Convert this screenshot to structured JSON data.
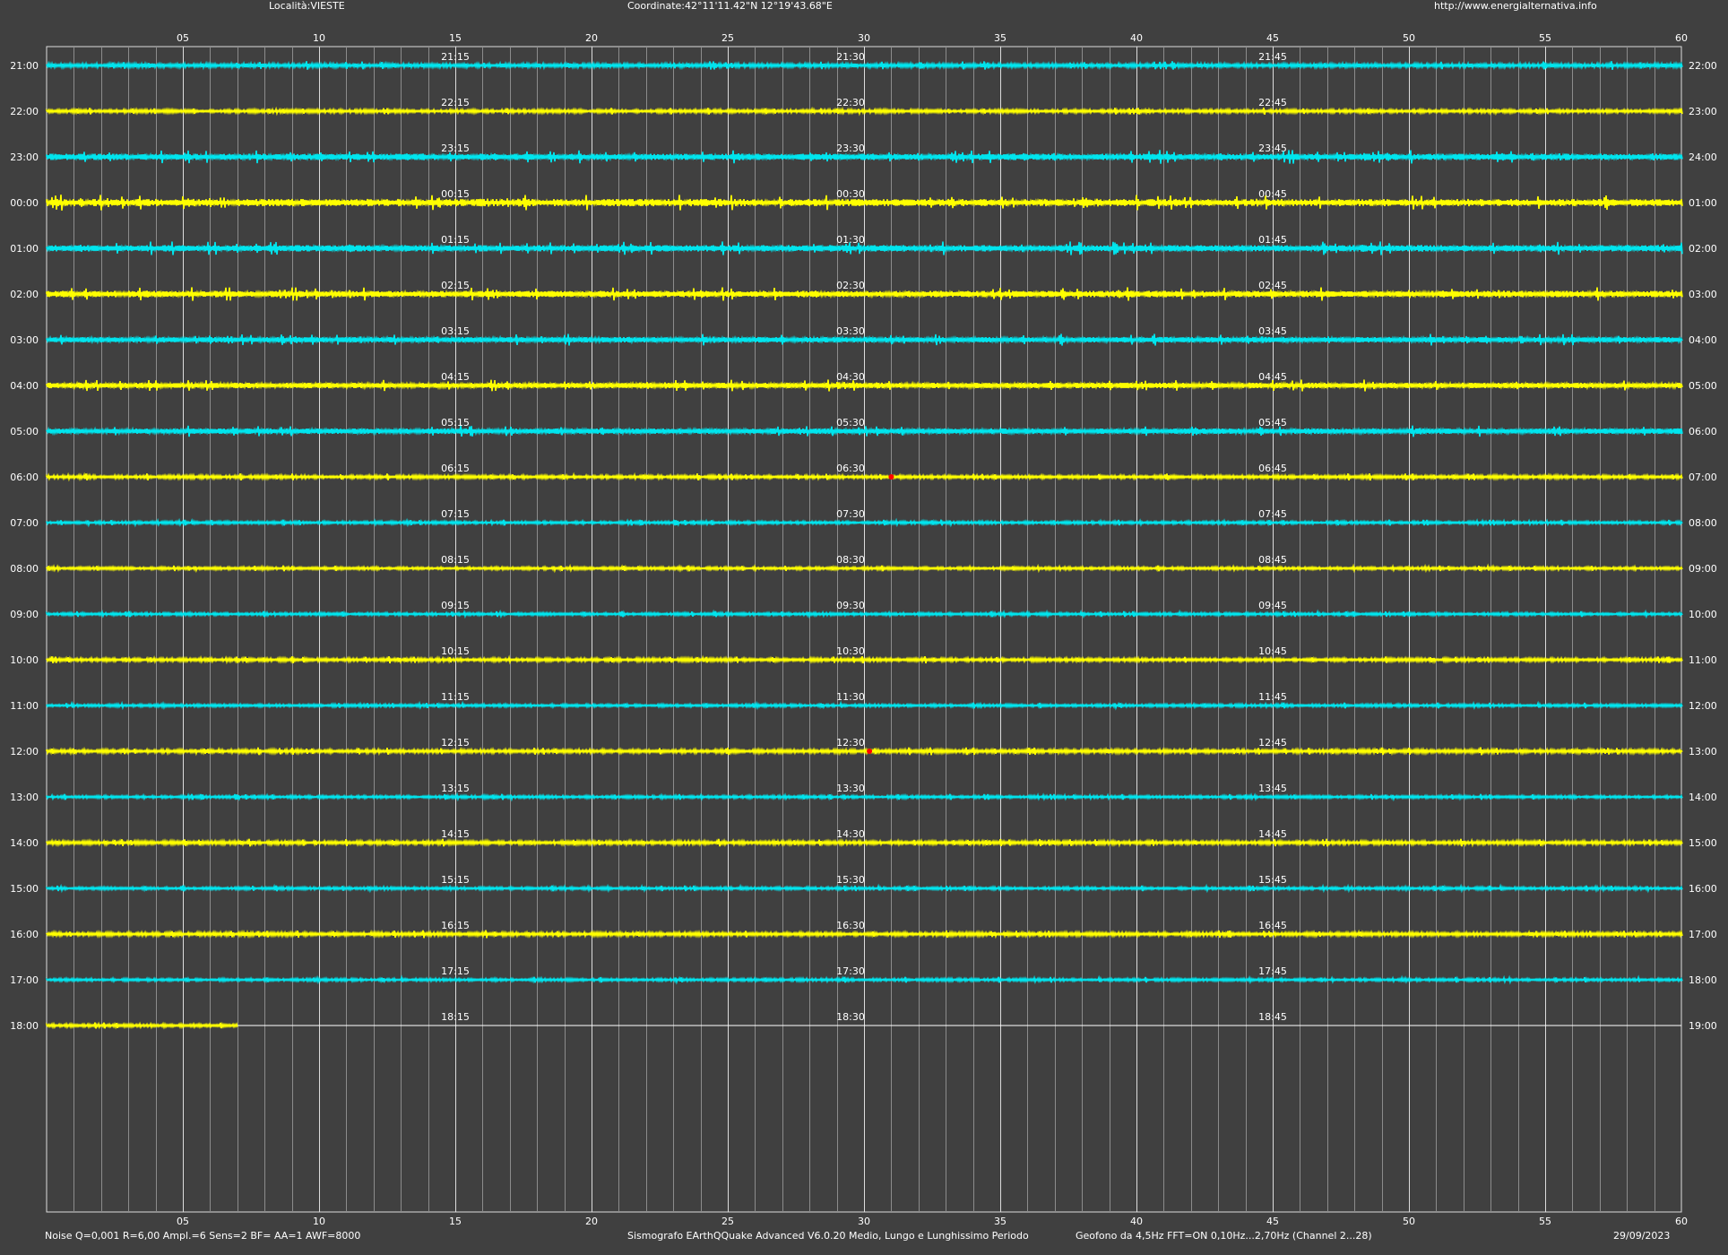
{
  "header": {
    "location": "Località:VIESTE",
    "coordinates": "Coordinate:42°11'11.42\"N  12°19'43.68\"E",
    "url": "http://www.energialternativa.info"
  },
  "footer": {
    "noise": "Noise Q=0,001 R=6,00 Ampl.=6 Sens=2 BF= AA=1 AWF=8000",
    "software": "Sismografo  EArthQQuake Advanced V6.0.20  Medio, Lungo e Lunghissimo Periodo",
    "geofono": "Geofono da 4,5Hz FFT=ON 0,10Hz...2,70Hz     (Channel 2...28)",
    "date": "29/09/2023"
  },
  "colors": {
    "background": "#404040",
    "cyan": "#00e5ee",
    "yellow": "#ffff00",
    "grid_major": "#dcdcdc",
    "grid_minor": "#8c8c8c",
    "event": "#ff0000"
  },
  "chart_data": {
    "type": "line",
    "x_ticks": [
      "05",
      "10",
      "15",
      "20",
      "25",
      "30",
      "35",
      "40",
      "45",
      "50",
      "55",
      "60"
    ],
    "x_range": [
      0,
      60
    ],
    "xlabel": "",
    "ylabel": "",
    "grid": true,
    "rows": [
      {
        "left": "21:00",
        "right": "22:00",
        "q1": "21:15",
        "q2": "21:30",
        "q3": "21:45",
        "color": "cyan",
        "amp": 2.2,
        "end": 60
      },
      {
        "left": "22:00",
        "right": "23:00",
        "q1": "22:15",
        "q2": "22:30",
        "q3": "22:45",
        "color": "yellow",
        "amp": 1.8,
        "end": 60
      },
      {
        "left": "23:00",
        "right": "24:00",
        "q1": "23:15",
        "q2": "23:30",
        "q3": "23:45",
        "color": "cyan",
        "amp": 3.5,
        "end": 60
      },
      {
        "left": "00:00",
        "right": "01:00",
        "q1": "00:15",
        "q2": "00:30",
        "q3": "00:45",
        "color": "yellow",
        "amp": 4.0,
        "end": 60
      },
      {
        "left": "01:00",
        "right": "02:00",
        "q1": "01:15",
        "q2": "01:30",
        "q3": "01:45",
        "color": "cyan",
        "amp": 3.5,
        "end": 60
      },
      {
        "left": "02:00",
        "right": "03:00",
        "q1": "02:15",
        "q2": "02:30",
        "q3": "02:45",
        "color": "yellow",
        "amp": 3.5,
        "end": 60
      },
      {
        "left": "03:00",
        "right": "04:00",
        "q1": "03:15",
        "q2": "03:30",
        "q3": "03:45",
        "color": "cyan",
        "amp": 3.0,
        "end": 60
      },
      {
        "left": "04:00",
        "right": "05:00",
        "q1": "04:15",
        "q2": "04:30",
        "q3": "04:45",
        "color": "yellow",
        "amp": 3.0,
        "end": 60
      },
      {
        "left": "05:00",
        "right": "06:00",
        "q1": "05:15",
        "q2": "05:30",
        "q3": "05:45",
        "color": "cyan",
        "amp": 3.0,
        "end": 60
      },
      {
        "left": "06:00",
        "right": "07:00",
        "q1": "06:15",
        "q2": "06:30",
        "q3": "06:45",
        "color": "yellow",
        "amp": 1.8,
        "end": 60,
        "event": 31.0
      },
      {
        "left": "07:00",
        "right": "08:00",
        "q1": "07:15",
        "q2": "07:30",
        "q3": "07:45",
        "color": "cyan",
        "amp": 1.5,
        "end": 60
      },
      {
        "left": "08:00",
        "right": "09:00",
        "q1": "08:15",
        "q2": "08:30",
        "q3": "08:45",
        "color": "yellow",
        "amp": 1.5,
        "end": 60
      },
      {
        "left": "09:00",
        "right": "10:00",
        "q1": "09:15",
        "q2": "09:30",
        "q3": "09:45",
        "color": "cyan",
        "amp": 1.5,
        "end": 60
      },
      {
        "left": "10:00",
        "right": "11:00",
        "q1": "10:15",
        "q2": "10:30",
        "q3": "10:45",
        "color": "yellow",
        "amp": 1.8,
        "end": 60
      },
      {
        "left": "11:00",
        "right": "12:00",
        "q1": "11:15",
        "q2": "11:30",
        "q3": "11:45",
        "color": "cyan",
        "amp": 1.5,
        "end": 60
      },
      {
        "left": "12:00",
        "right": "13:00",
        "q1": "12:15",
        "q2": "12:30",
        "q3": "12:45",
        "color": "yellow",
        "amp": 2.0,
        "end": 60,
        "event": 30.2
      },
      {
        "left": "13:00",
        "right": "14:00",
        "q1": "13:15",
        "q2": "13:30",
        "q3": "13:45",
        "color": "cyan",
        "amp": 1.5,
        "end": 60
      },
      {
        "left": "14:00",
        "right": "15:00",
        "q1": "14:15",
        "q2": "14:30",
        "q3": "14:45",
        "color": "yellow",
        "amp": 2.0,
        "end": 60
      },
      {
        "left": "15:00",
        "right": "16:00",
        "q1": "15:15",
        "q2": "15:30",
        "q3": "15:45",
        "color": "cyan",
        "amp": 1.5,
        "end": 60
      },
      {
        "left": "16:00",
        "right": "17:00",
        "q1": "16:15",
        "q2": "16:30",
        "q3": "16:45",
        "color": "yellow",
        "amp": 2.0,
        "end": 60
      },
      {
        "left": "17:00",
        "right": "18:00",
        "q1": "17:15",
        "q2": "17:30",
        "q3": "17:45",
        "color": "cyan",
        "amp": 1.5,
        "end": 60
      },
      {
        "left": "18:00",
        "right": "19:00",
        "q1": "18:15",
        "q2": "18:30",
        "q3": "18:45",
        "color": "yellow",
        "amp": 1.8,
        "end": 7
      }
    ]
  }
}
